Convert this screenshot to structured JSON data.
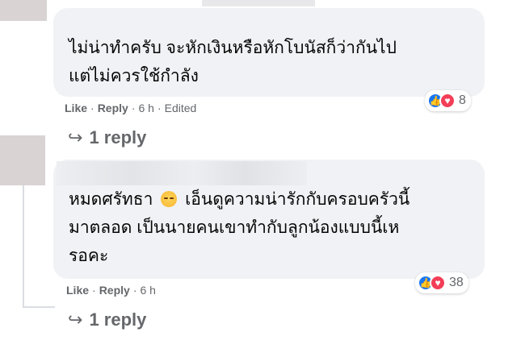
{
  "comments": [
    {
      "text_line1": "ไม่น่าทำครับ จะหักเงินหรือหักโบนัสก็ว่ากันไป",
      "text_line2": "แต่ไม่ควรใช้กำลัง",
      "like_label": "Like",
      "reply_label": "Reply",
      "time": "6 h",
      "edited": "Edited",
      "reaction_count": "8",
      "replies_label": "1 reply",
      "reactions": [
        "like-icon",
        "love-icon"
      ]
    },
    {
      "text_part1": "หมดศรัทธา",
      "text_part2": "เอ็นดูความน่ารักกับครอบครัวนี้",
      "text_line2": "มาตลอด เป็นนายคนเขาทำกับลูกน้องแบบนี้เห",
      "text_line3": "รอคะ",
      "emoji": "sad-face-emoji",
      "like_label": "Like",
      "reply_label": "Reply",
      "time": "6 h",
      "reaction_count": "38",
      "replies_label": "1 reply",
      "reactions": [
        "like-icon",
        "love-icon"
      ]
    }
  ],
  "colors": {
    "bubble": "#f0f2f5",
    "meta_text": "#65676b",
    "like_blue": "#1877f2",
    "love_red": "#f33e58"
  }
}
